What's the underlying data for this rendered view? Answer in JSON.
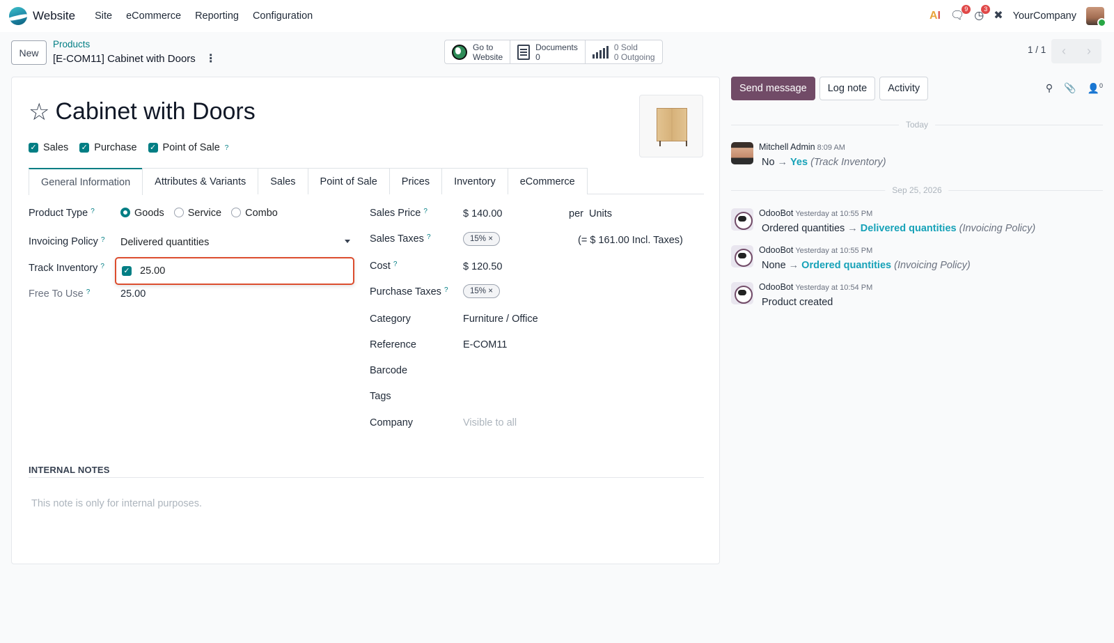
{
  "navbar": {
    "app_name": "Website",
    "menu": [
      "Site",
      "eCommerce",
      "Reporting",
      "Configuration"
    ],
    "messages_badge": "9",
    "activities_badge": "3",
    "company": "YourCompany"
  },
  "control": {
    "new_label": "New",
    "breadcrumb_parent": "Products",
    "breadcrumb_current": "[E-COM11] Cabinet with Doors",
    "smart_buttons": {
      "website_line1": "Go to",
      "website_line2": "Website",
      "documents_label": "Documents",
      "documents_count": "0",
      "sold": "0 Sold",
      "outgoing": "0 Outgoing"
    },
    "pager": "1 / 1"
  },
  "form": {
    "title": "Cabinet with Doors",
    "checks": {
      "sales": "Sales",
      "purchase": "Purchase",
      "pos": "Point of Sale"
    },
    "tabs": [
      "General Information",
      "Attributes & Variants",
      "Sales",
      "Point of Sale",
      "Prices",
      "Inventory",
      "eCommerce"
    ],
    "left": {
      "product_type_label": "Product Type",
      "types": [
        "Goods",
        "Service",
        "Combo"
      ],
      "invoicing_label": "Invoicing Policy",
      "invoicing_value": "Delivered quantities",
      "track_label": "Track Inventory",
      "track_value": "25.00",
      "free_label": "Free To Use",
      "free_value": "25.00"
    },
    "right": {
      "sales_price_label": "Sales Price",
      "sales_price_value": "$ 140.00",
      "per": "per",
      "uom": "Units",
      "sales_taxes_label": "Sales Taxes",
      "sales_tax_tag": "15%",
      "incl_taxes": "(= $ 161.00 Incl. Taxes)",
      "cost_label": "Cost",
      "cost_value": "$ 120.50",
      "purchase_taxes_label": "Purchase Taxes",
      "purchase_tax_tag": "15%",
      "category_label": "Category",
      "category_value": "Furniture / Office",
      "reference_label": "Reference",
      "reference_value": "E-COM11",
      "barcode_label": "Barcode",
      "tags_label": "Tags",
      "company_label": "Company",
      "company_placeholder": "Visible to all"
    },
    "notes_header": "INTERNAL NOTES",
    "notes_placeholder": "This note is only for internal purposes."
  },
  "chatter": {
    "send_message": "Send message",
    "log_note": "Log note",
    "activity": "Activity",
    "followers_count": "0",
    "sep_today": "Today",
    "sep_date": "Sep 25, 2026",
    "messages": [
      {
        "author": "Mitchell Admin",
        "time": "8:09 AM",
        "old": "No",
        "new": "Yes",
        "field": "(Track Inventory)"
      },
      {
        "author": "OdooBot",
        "time": "Yesterday at 10:55 PM",
        "old": "Ordered quantities",
        "new": "Delivered quantities",
        "field": "(Invoicing Policy)"
      },
      {
        "author": "OdooBot",
        "time": "Yesterday at 10:55 PM",
        "old": "None",
        "new": "Ordered quantities",
        "field": "(Invoicing Policy)"
      },
      {
        "author": "OdooBot",
        "time": "Yesterday at 10:54 PM",
        "text": "Product created"
      }
    ]
  },
  "colors": {
    "brand": "#714b67",
    "accent": "#017e84",
    "highlight": "#dc4d2e"
  }
}
